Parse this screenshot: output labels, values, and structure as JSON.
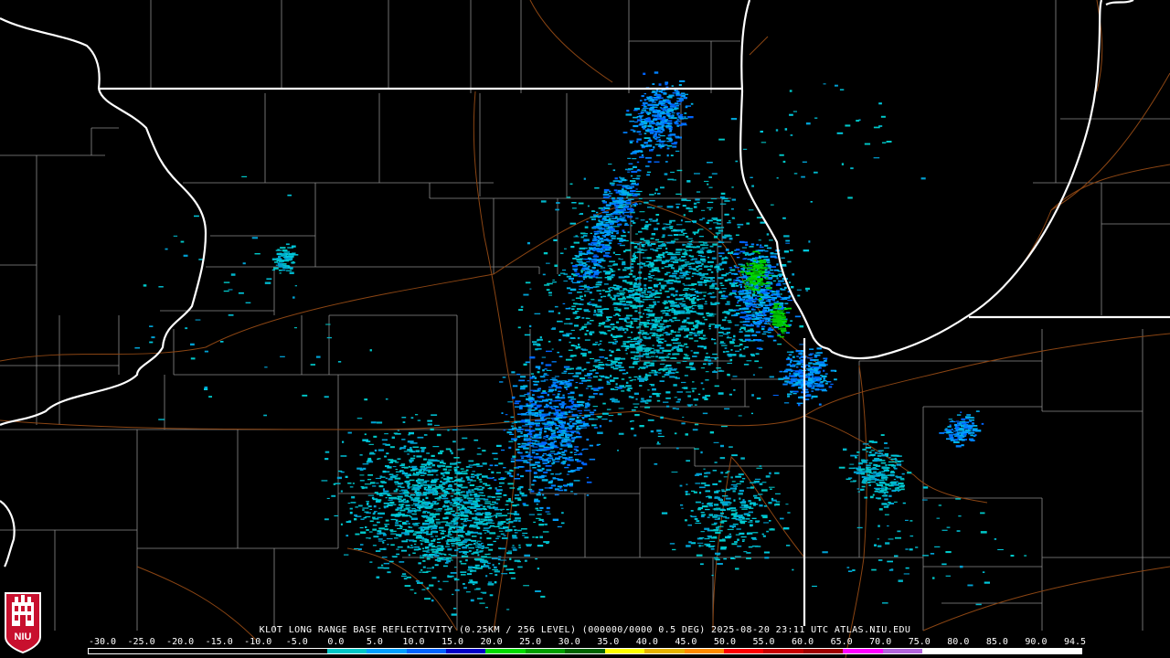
{
  "caption": "KLOT LONG RANGE BASE REFLECTIVITY (0.25KM / 256 LEVEL) (000000/0000 0.5 DEG) 2025-08-20 23:11 UTC  ATLAS.NIU.EDU",
  "logo_text": "NIU",
  "colors": {
    "background": "#000000",
    "state_border": "#ffffff",
    "county_border": "#8c8c8c",
    "highway": "#8b4513",
    "logo_red": "#c8102e"
  },
  "scale": {
    "labels": [
      "-30.0",
      "-25.0",
      "-20.0",
      "-15.0",
      "-10.0",
      "-5.0",
      "0.0",
      "5.0",
      "10.0",
      "15.0",
      "20.0",
      "25.0",
      "30.0",
      "35.0",
      "40.0",
      "45.0",
      "50.0",
      "55.0",
      "60.0",
      "65.0",
      "70.0",
      "75.0",
      "80.0",
      "85.0",
      "90.0",
      "94.5"
    ],
    "colors": [
      "#000000",
      "#000000",
      "#000000",
      "#000000",
      "#000000",
      "#000000",
      "#00c8c8",
      "#00a0ff",
      "#0064ff",
      "#0000c8",
      "#00dc00",
      "#00a000",
      "#006400",
      "#ffff00",
      "#e6b400",
      "#ff8c00",
      "#ff0000",
      "#c80000",
      "#a00000",
      "#ff00ff",
      "#b464dc",
      "#ffffff",
      "#ffffff",
      "#ffffff",
      "#ffffff"
    ]
  }
}
